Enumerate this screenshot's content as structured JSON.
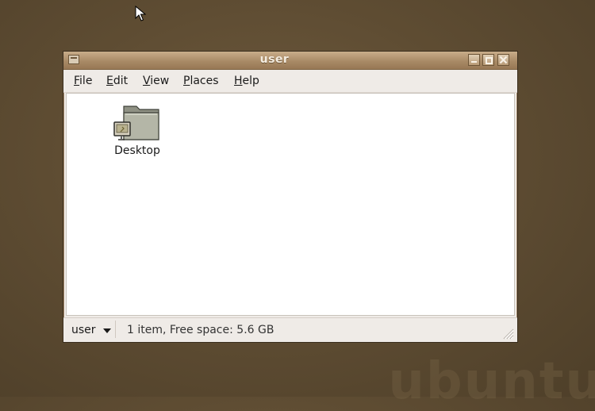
{
  "window": {
    "title": "user"
  },
  "menu": {
    "items": [
      {
        "label": "File",
        "mnemonic": "F",
        "rest": "ile"
      },
      {
        "label": "Edit",
        "mnemonic": "E",
        "rest": "dit"
      },
      {
        "label": "View",
        "mnemonic": "V",
        "rest": "iew"
      },
      {
        "label": "Places",
        "mnemonic": "P",
        "rest": "laces"
      },
      {
        "label": "Help",
        "mnemonic": "H",
        "rest": "elp"
      }
    ]
  },
  "content": {
    "items": [
      {
        "label": "Desktop",
        "icon": "folder-desktop-icon"
      }
    ]
  },
  "statusbar": {
    "location": "user",
    "status": "1 item, Free space: 5.6 GB"
  },
  "colors": {
    "desktop_bg": "#5f4d33",
    "titlebar": "#a98a66",
    "window_bg": "#efebe7",
    "content_bg": "#ffffff"
  }
}
